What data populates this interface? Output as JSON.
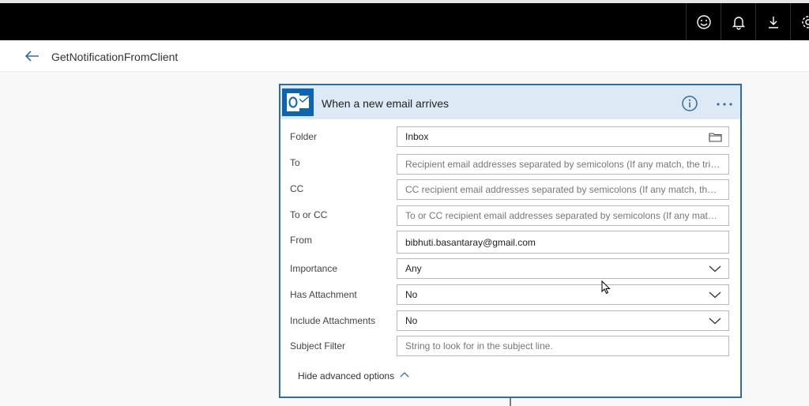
{
  "topbar": {
    "icons": [
      "smiley-icon",
      "bell-icon",
      "download-icon",
      "gear-icon"
    ]
  },
  "header": {
    "flow_name": "GetNotificationFromClient"
  },
  "trigger": {
    "title": "When a new email arrives",
    "fields": [
      {
        "label": "Folder",
        "value": "Inbox",
        "placeholder": ""
      },
      {
        "label": "To",
        "value": "",
        "placeholder": "Recipient email addresses separated by semicolons (If any match, the trigger will run)"
      },
      {
        "label": "CC",
        "value": "",
        "placeholder": "CC recipient email addresses separated by semicolons (If any match, the trigger will run)"
      },
      {
        "label": "To or CC",
        "value": "",
        "placeholder": "To or CC recipient email addresses separated by semicolons (If any match, the trigger will run)"
      },
      {
        "label": "From",
        "value": "bibhuti.basantaray@gmail.com",
        "placeholder": ""
      },
      {
        "label": "Importance",
        "value": "Any",
        "placeholder": ""
      },
      {
        "label": "Has Attachment",
        "value": "No",
        "placeholder": ""
      },
      {
        "label": "Include Attachments",
        "value": "No",
        "placeholder": ""
      },
      {
        "label": "Subject Filter",
        "value": "",
        "placeholder": "String to look for in the subject line."
      }
    ],
    "advanced_toggle": "Hide advanced options"
  },
  "colors": {
    "accent": "#2f6da4",
    "header_bg": "#dde9f5",
    "outlook_blue": "#0b64b4"
  }
}
